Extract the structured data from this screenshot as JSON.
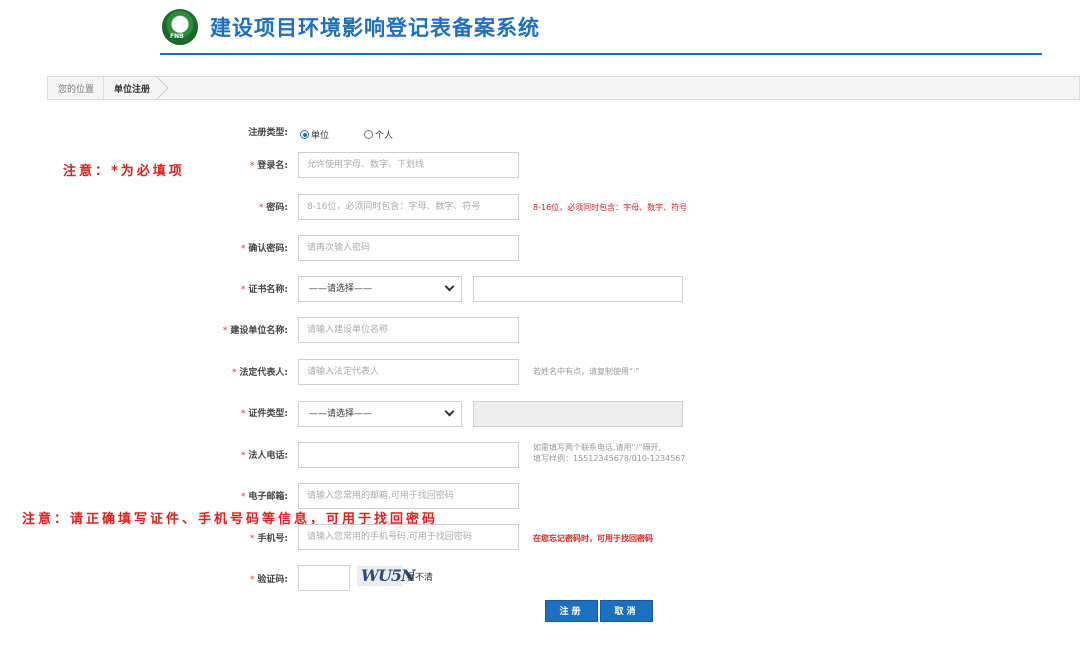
{
  "header": {
    "logo_text": "FNB",
    "title": "建设项目环境影响登记表备案系统"
  },
  "breadcrumb": {
    "location_label": "您的位置",
    "current": "单位注册"
  },
  "notes": {
    "required_note": "注意：*为必填项",
    "info_note": "注意：请正确填写证件、手机号码等信息，可用于找回密码"
  },
  "form": {
    "reg_type": {
      "label": "注册类型:",
      "options": [
        "单位",
        "个人"
      ],
      "selected": "单位"
    },
    "login_name": {
      "label": "登录名:",
      "placeholder": "允许使用字母、数字、下划线"
    },
    "password": {
      "label": "密码:",
      "placeholder": "8-16位，必须同时包含：字母、数字、符号",
      "hint": "8-16位，必须同时包含：字母、数字、符号"
    },
    "confirm_password": {
      "label": "确认密码:",
      "placeholder": "请再次输入密码"
    },
    "cert_name": {
      "label": "证书名称:",
      "selected": "——请选择——",
      "value": ""
    },
    "company_name": {
      "label": "建设单位名称:",
      "placeholder": "请输入建设单位名称"
    },
    "legal_rep": {
      "label": "法定代表人:",
      "placeholder": "请输入法定代表人",
      "hint": "若姓名中有点，请复制使用“·”"
    },
    "id_type": {
      "label": "证件类型:",
      "selected": "——请选择——",
      "value": ""
    },
    "legal_phone": {
      "label": "法人电话:",
      "value": "",
      "hint_line1": "如需填写两个联系电话,请用“/”隔开,",
      "hint_line2": "填写样例：15512345678/010-1234567"
    },
    "email": {
      "label": "电子邮箱:",
      "placeholder": "请输入您常用的邮箱,可用于找回密码"
    },
    "mobile": {
      "label": "手机号:",
      "placeholder": "请输入您常用的手机号码,可用于找回密码",
      "hint": "在您忘记密码时，可用于找回密码"
    },
    "captcha": {
      "label": "验证码:",
      "value": "",
      "image_text": "WU5N",
      "refresh_label": "看不清"
    },
    "required_mark": "*"
  },
  "buttons": {
    "register": "注册",
    "cancel": "取消"
  },
  "colors": {
    "primary": "#1d6fc0",
    "warning": "#e02020"
  }
}
